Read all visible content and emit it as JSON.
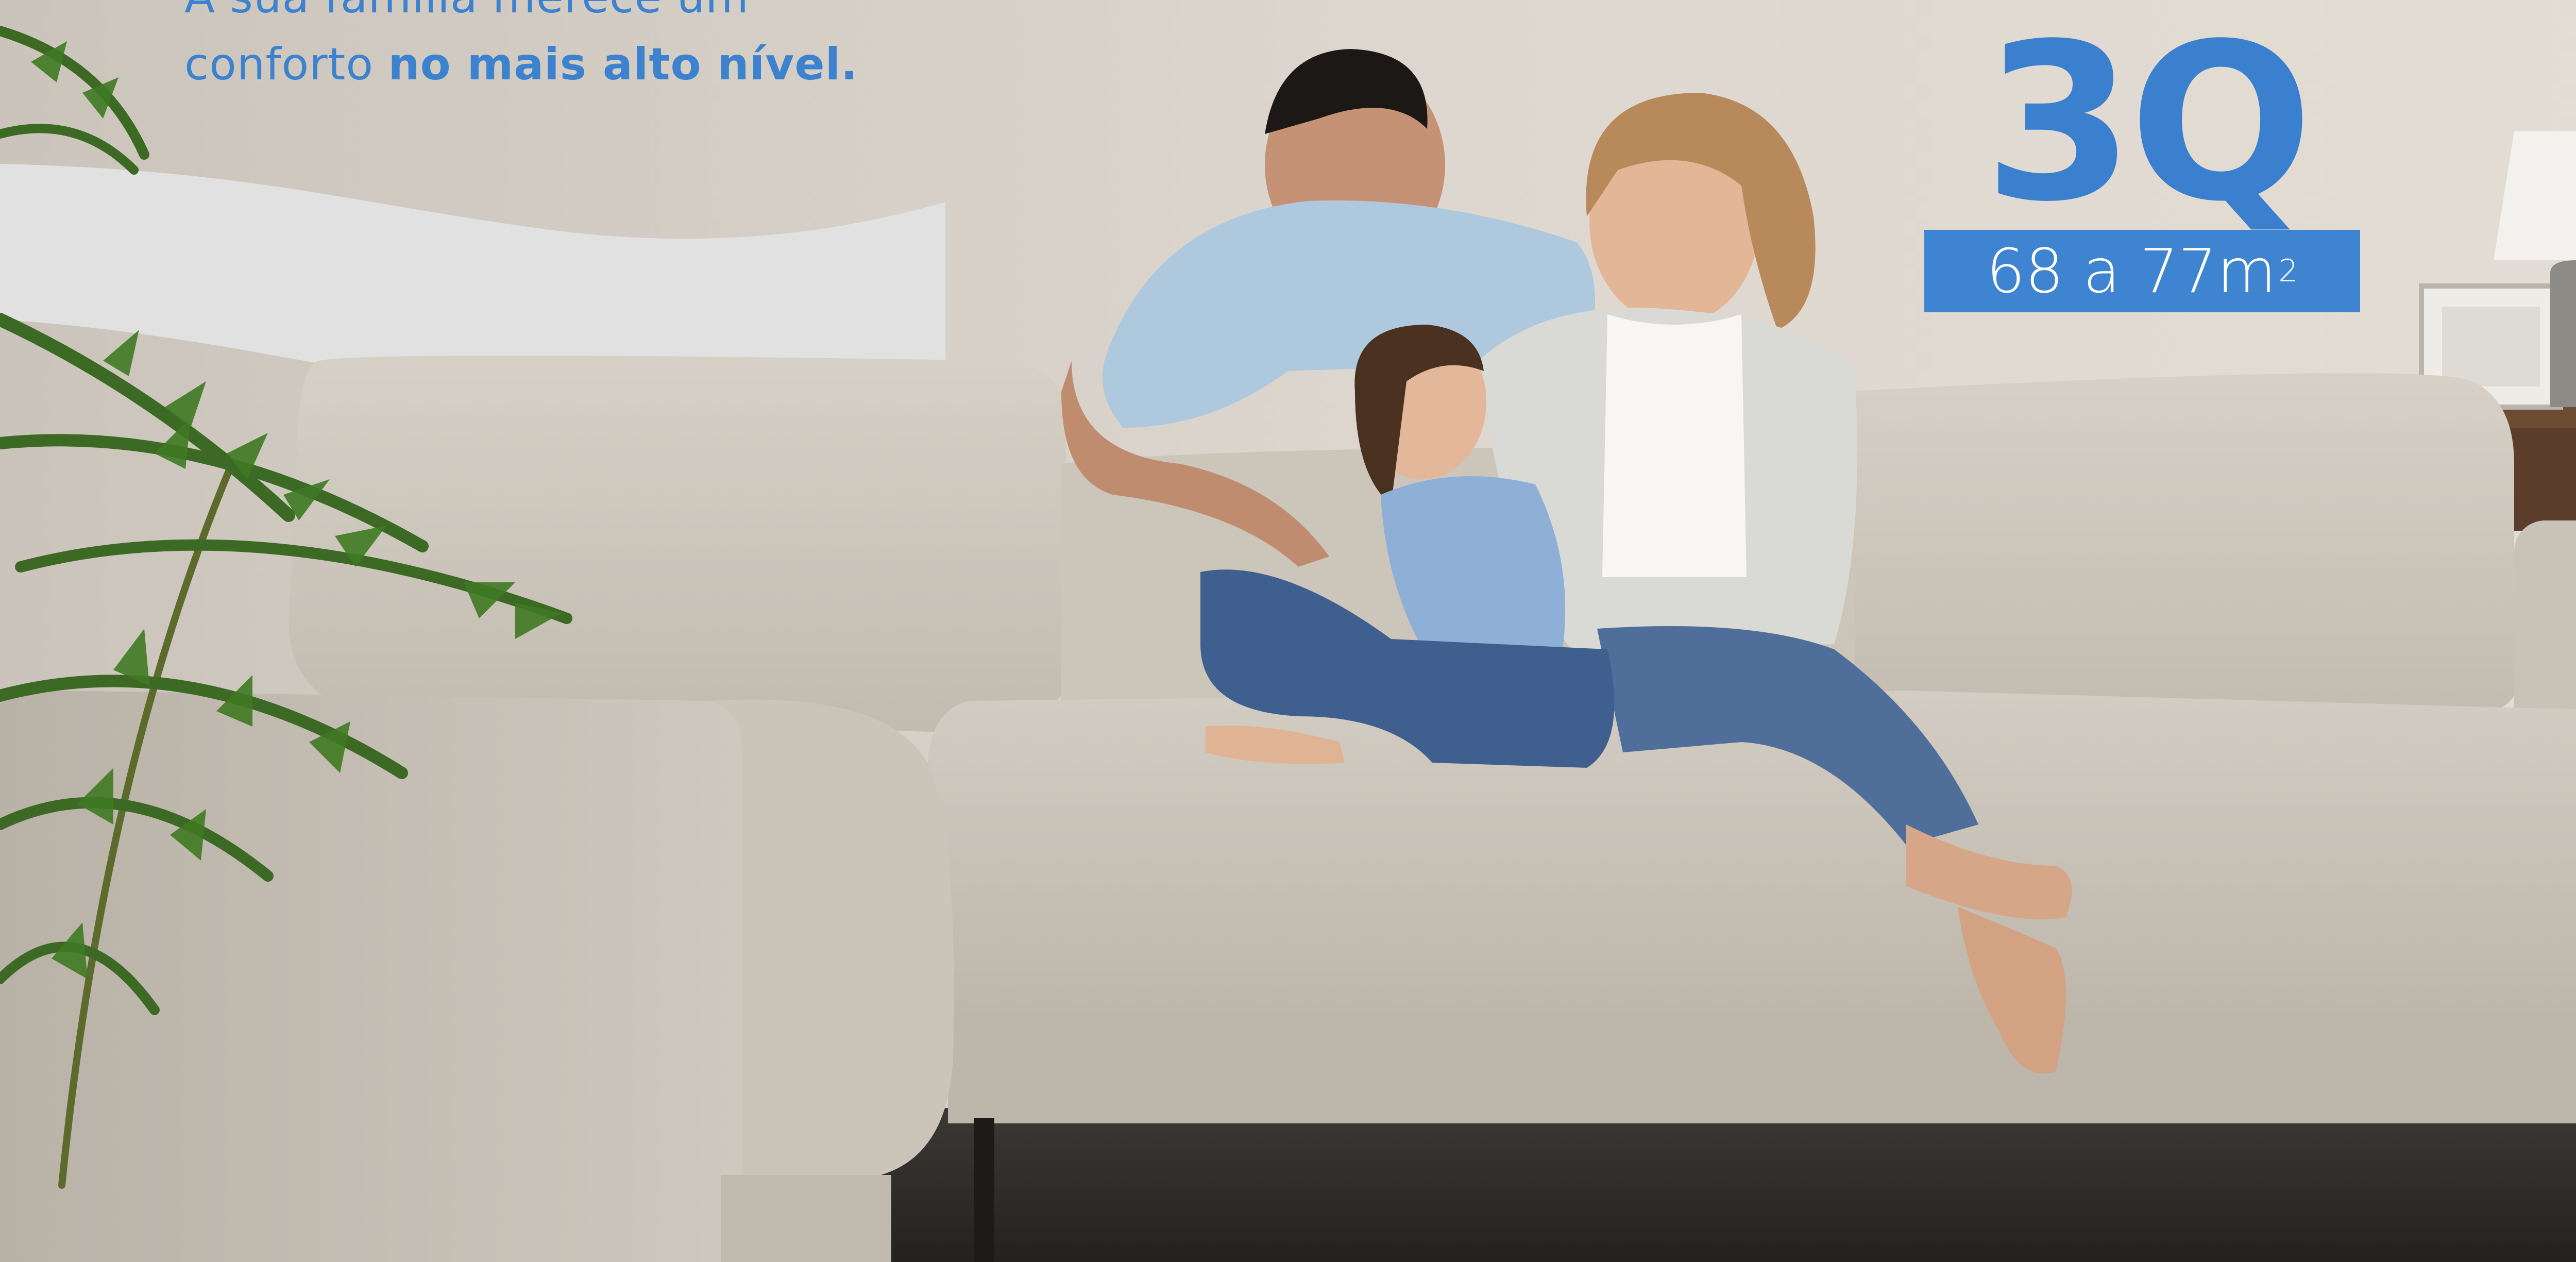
{
  "headline": {
    "line1": "A sua família merece um",
    "line2_regular": "conforto",
    "line2_bold": "no mais alto nível."
  },
  "badge": {
    "big_text": "3Q",
    "area_text": "68 a 77m",
    "area_superscript": "2"
  },
  "colors": {
    "brand_blue": "#3f84d0",
    "wall": "#d9d3cb",
    "sofa": "#cdc6bc",
    "floor": "#2b2a29"
  }
}
